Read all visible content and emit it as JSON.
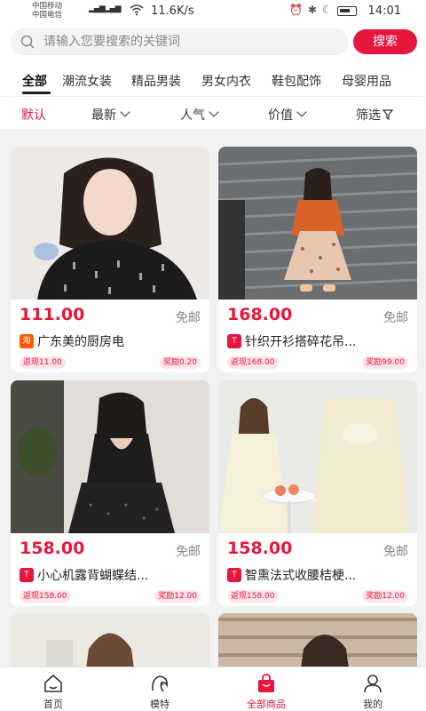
{
  "status_bar": {
    "carrier_1": "中国移动",
    "carrier_2": "中国电信",
    "network_speed": "11.6K/s",
    "time": "14:01"
  },
  "search": {
    "placeholder": "请输入您要搜索的关键词",
    "button_label": "搜索"
  },
  "categories": [
    {
      "label": "全部",
      "active": true
    },
    {
      "label": "潮流女装",
      "active": false
    },
    {
      "label": "精品男装",
      "active": false
    },
    {
      "label": "男女内衣",
      "active": false
    },
    {
      "label": "鞋包配饰",
      "active": false
    },
    {
      "label": "母婴用品",
      "active": false
    }
  ],
  "sort_options": [
    {
      "label": "默认",
      "active": true
    },
    {
      "label": "最新",
      "active": false
    },
    {
      "label": "人气",
      "active": false
    },
    {
      "label": "价值",
      "active": false
    },
    {
      "label": "筛选",
      "active": false
    }
  ],
  "products": [
    {
      "price": "111.00",
      "shipping": "免邮",
      "shop_icon": "taobao-icon",
      "shop_icon_text": "淘",
      "title": "广东美的厨房电",
      "cashback": "返现11.00",
      "reward": "奖励0.20"
    },
    {
      "price": "168.00",
      "shipping": "免邮",
      "shop_icon": "tmall-icon",
      "shop_icon_text": "T",
      "title": "针织开衫搭碎花吊...",
      "cashback": "返现168.00",
      "reward": "奖励99.00"
    },
    {
      "price": "158.00",
      "shipping": "免邮",
      "shop_icon": "tmall-icon",
      "shop_icon_text": "T",
      "title": "小心机露背蝴蝶结...",
      "cashback": "返现158.00",
      "reward": "奖励12.00"
    },
    {
      "price": "158.00",
      "shipping": "免邮",
      "shop_icon": "tmall-icon",
      "shop_icon_text": "T",
      "title": "智熏法式收腰桔梗...",
      "cashback": "返现158.00",
      "reward": "奖励12.00"
    }
  ],
  "bottom_nav": [
    {
      "label": "首页",
      "icon": "home-icon",
      "active": false
    },
    {
      "label": "模特",
      "icon": "model-icon",
      "active": false
    },
    {
      "label": "全部商品",
      "icon": "shopping-bag-icon",
      "active": true
    },
    {
      "label": "我的",
      "icon": "user-icon",
      "active": false
    }
  ],
  "colors": {
    "accent": "#e8153c",
    "tag_bg": "#fde5ea",
    "background": "#f2f2f2"
  }
}
